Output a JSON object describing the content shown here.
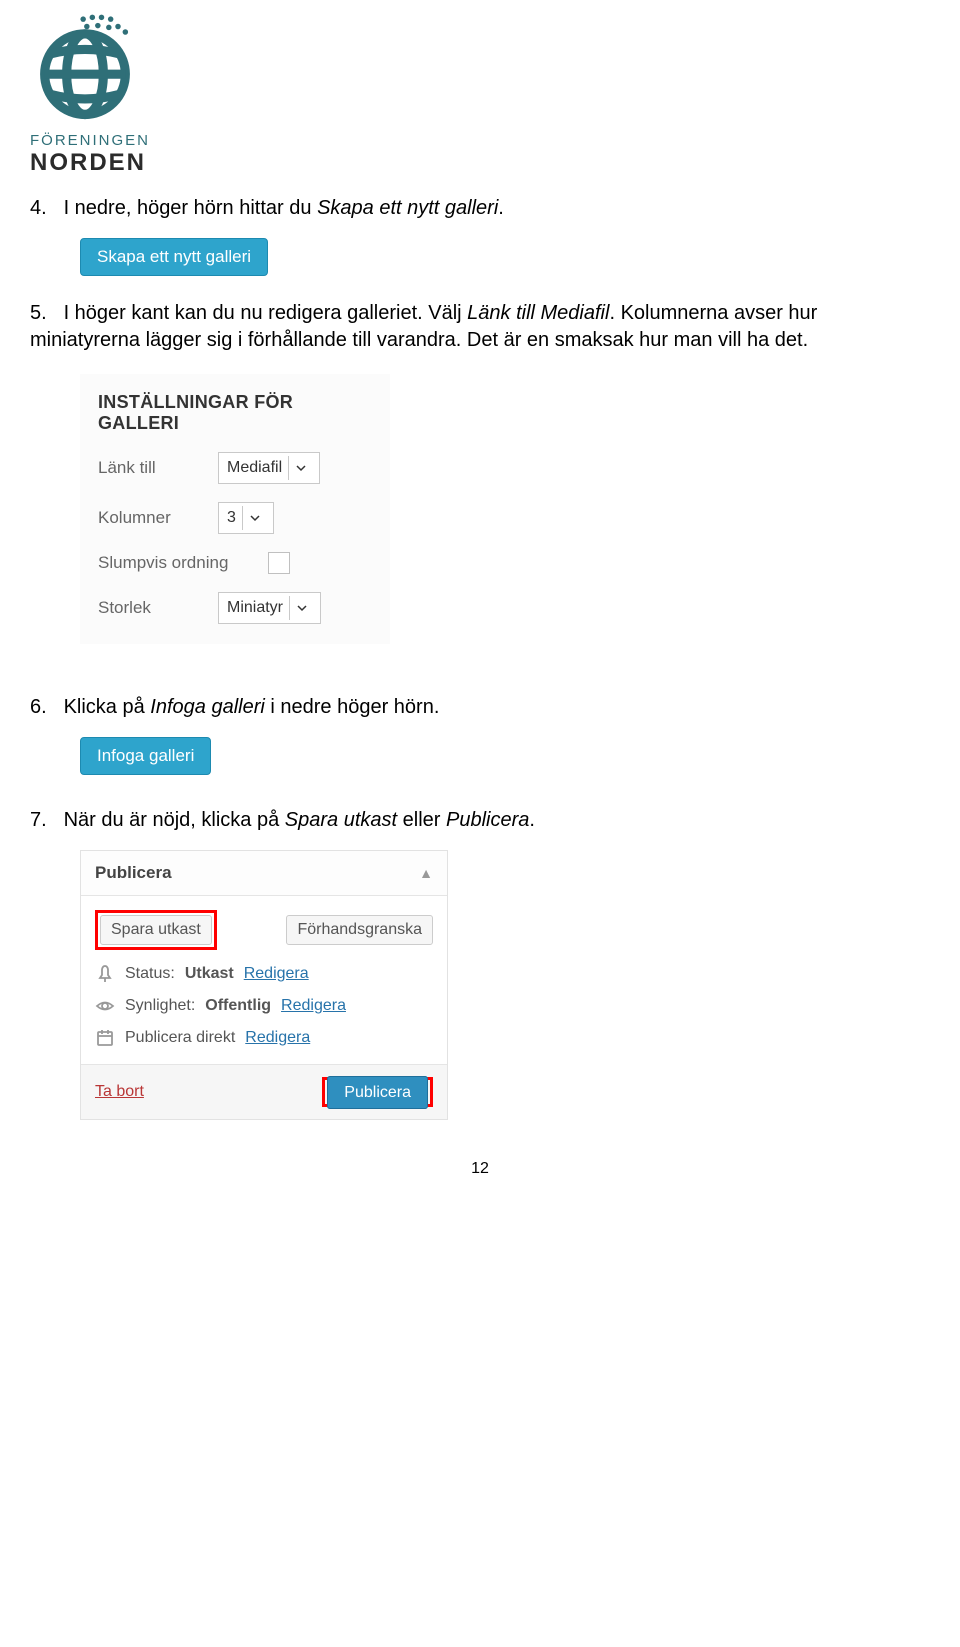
{
  "logo": {
    "line1": "FÖRENINGEN",
    "line2": "NORDEN"
  },
  "step4": {
    "num": "4.",
    "text_before": "I nedre, höger hörn hittar du ",
    "italic": "Skapa ett nytt galleri",
    "text_after": "."
  },
  "btn_create_gallery": "Skapa ett nytt galleri",
  "step5": {
    "num": "5.",
    "t1": "I höger kant kan du nu redigera galleriet. Välj ",
    "i1": "Länk till Mediafil",
    "t2": ". Kolumnerna avser hur miniatyrerna lägger sig i förhållande till varandra. Det är en smaksak hur man vill ha det."
  },
  "settings": {
    "title": "INSTÄLLNINGAR FÖR GALLERI",
    "link_label": "Länk till",
    "link_value": "Mediafil",
    "cols_label": "Kolumner",
    "cols_value": "3",
    "random_label": "Slumpvis ordning",
    "size_label": "Storlek",
    "size_value": "Miniatyr"
  },
  "step6": {
    "num": "6.",
    "t1": "Klicka på ",
    "i1": "Infoga galleri",
    "t2": " i nedre höger hörn."
  },
  "btn_insert_gallery": "Infoga galleri",
  "step7": {
    "num": "7.",
    "t1": "När du är nöjd, klicka på ",
    "i1": "Spara utkast",
    "mid": " eller ",
    "i2": "Publicera",
    "t2": "."
  },
  "publish": {
    "title": "Publicera",
    "save_draft": "Spara utkast",
    "preview": "Förhandsgranska",
    "status_label": "Status:",
    "status_value": "Utkast",
    "visibility_label": "Synlighet:",
    "visibility_value": "Offentlig",
    "pubtime": "Publicera direkt",
    "edit": "Redigera",
    "delete": "Ta bort",
    "publish_btn": "Publicera"
  },
  "pagenum": "12"
}
